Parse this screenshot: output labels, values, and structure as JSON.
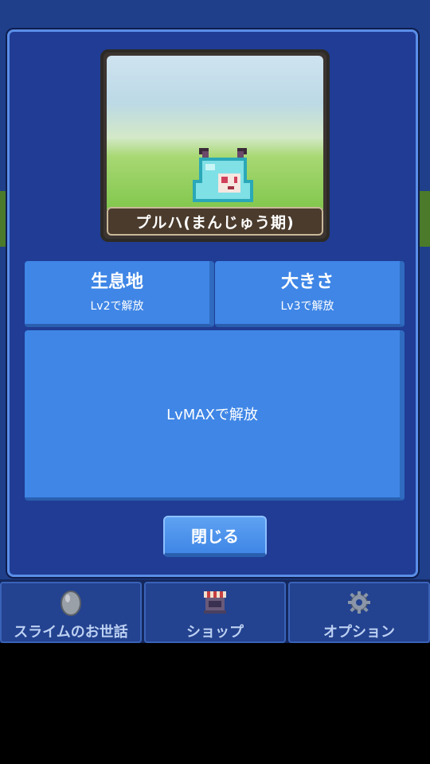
{
  "character": {
    "name": "プルハ(まんじゅう期)"
  },
  "cards": {
    "habitat": {
      "title": "生息地",
      "unlock": "Lv2で解放"
    },
    "size": {
      "title": "大きさ",
      "unlock": "Lv3で解放"
    },
    "max": {
      "unlock": "LvMAXで解放"
    }
  },
  "buttons": {
    "close": "閉じる"
  },
  "tabs": [
    {
      "label": "スライムのお世話",
      "icon": "egg-icon"
    },
    {
      "label": "ショップ",
      "icon": "shop-icon"
    },
    {
      "label": "オプション",
      "icon": "gear-icon"
    }
  ],
  "colors": {
    "panel": "#203c94",
    "card": "#3f86e6",
    "tab": "#23428f"
  }
}
